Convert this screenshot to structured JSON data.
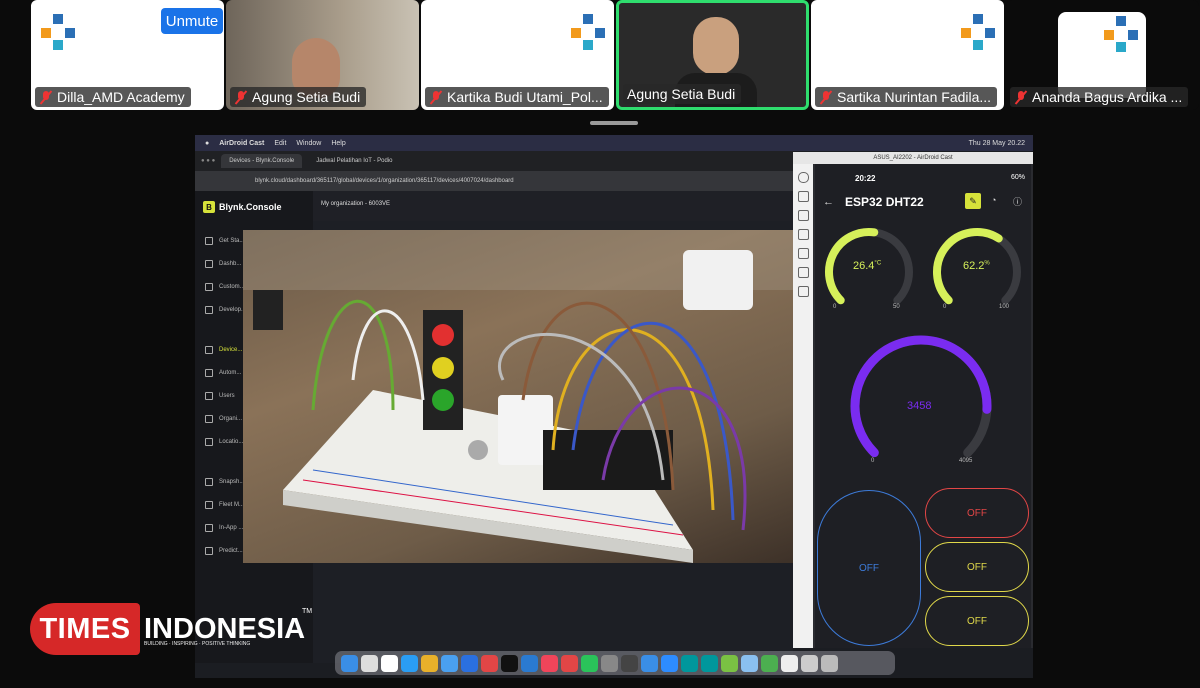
{
  "participants": [
    {
      "name": "Dilla_AMD Academy",
      "muted": true
    },
    {
      "name": "Agung Setia Budi",
      "muted": true
    },
    {
      "name": "Kartika Budi Utami_Pol...",
      "muted": true
    },
    {
      "name": "Agung Setia Budi",
      "muted": false,
      "speaking": true
    },
    {
      "name": "Sartika Nurintan Fadila...",
      "muted": true
    },
    {
      "name": "Ananda Bagus Ardika ...",
      "muted": true
    }
  ],
  "controls": {
    "unmute_label": "Unmute",
    "more_label": "···"
  },
  "shared": {
    "mac_menu": [
      "AirDroid Cast",
      "Edit",
      "Window",
      "Help"
    ],
    "mac_clock": "Thu 28 May  20.22",
    "browser_tabs": [
      "Devices - Blynk.Console",
      "Jadwal Pelatihan IoT - Podio"
    ],
    "url": "blynk.cloud/dashboard/365117/global/devices/1/organization/365117/devices/4007024/dashboard",
    "blynk": {
      "logo": "Blynk.Console",
      "org": "My organization - 6003VE",
      "sidebar": [
        "Get Sta...",
        "Dashb...",
        "Custom...",
        "Develop...",
        "Device...",
        "Autom...",
        "Users",
        "Organi...",
        "Locatio...",
        "Snapsh...",
        "Fleet M...",
        "In-App ...",
        "Predict..."
      ]
    },
    "airdroid": {
      "window_title": "ASUS_AI2202 - AirDroid Cast",
      "time": "20:22",
      "battery": "60%",
      "device_name": "ESP32 DHT22",
      "gauges": [
        {
          "value": "26.4",
          "unit": "°C",
          "min": "0",
          "max": "50",
          "fraction": 0.528,
          "color": "#d6f05a"
        },
        {
          "value": "62.2",
          "unit": "%",
          "min": "0",
          "max": "100",
          "fraction": 0.622,
          "color": "#d6f05a"
        },
        {
          "value": "3458",
          "unit": "",
          "min": "0",
          "max": "4095",
          "fraction": 0.844,
          "color": "#7a2cf0"
        }
      ],
      "buttons": [
        {
          "label": "OFF",
          "color": "#3d7bd9"
        },
        {
          "label": "OFF",
          "color": "#e24646"
        },
        {
          "label": "OFF",
          "color": "#e0d84a"
        },
        {
          "label": "OFF",
          "color": "#e0d84a"
        }
      ]
    }
  },
  "watermark": {
    "brand1": "TIMES",
    "brand2": "INDONESIA",
    "tagline": "BUILDING · INSPIRING · POSITIVE THINKING",
    "tm": "TM"
  }
}
